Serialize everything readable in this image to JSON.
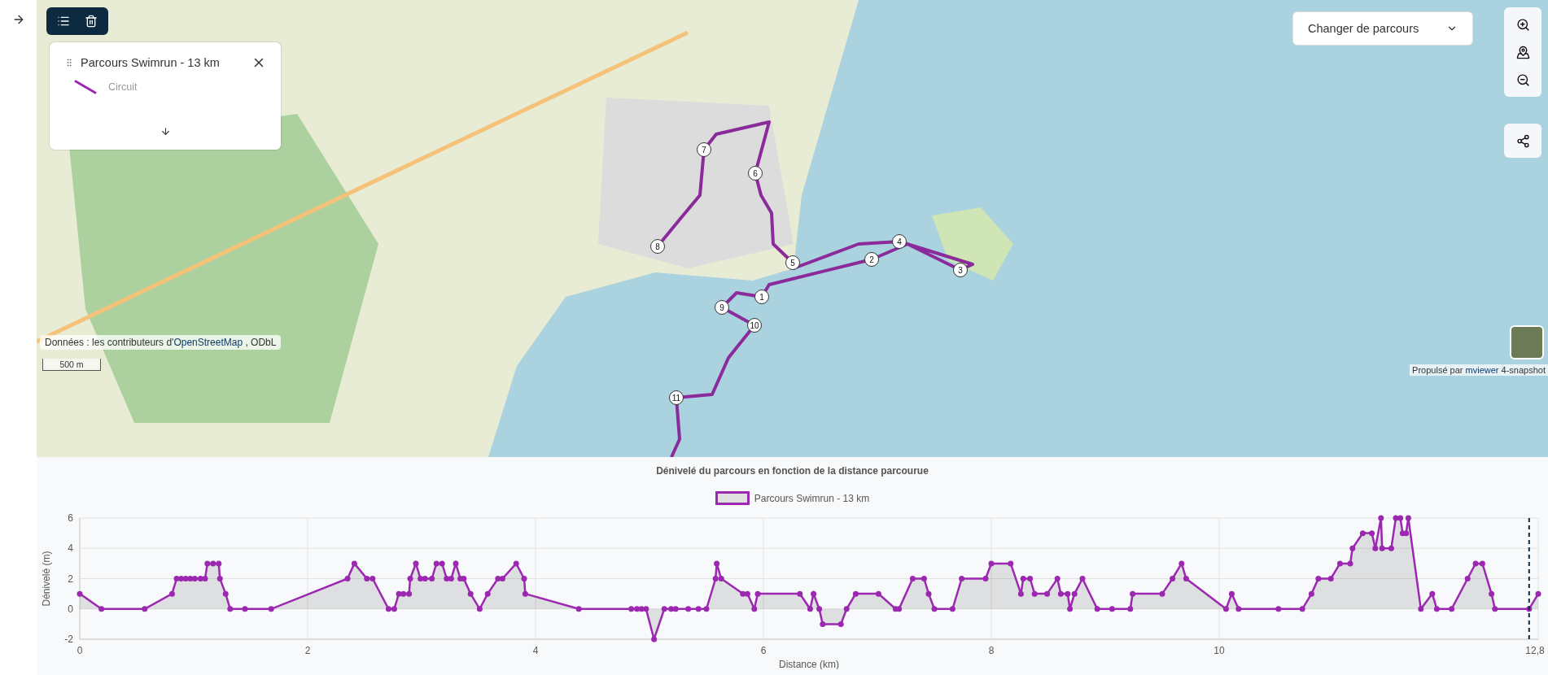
{
  "map": {
    "layer_panel": {
      "title": "Parcours Swimrun - 13 km",
      "layers": [
        {
          "label": "Circuit"
        }
      ]
    },
    "route_select": {
      "label": "Changer de parcours"
    },
    "markers": [
      {
        "label": "1"
      },
      {
        "label": "2"
      },
      {
        "label": "3"
      },
      {
        "label": "4"
      },
      {
        "label": "5"
      },
      {
        "label": "6"
      },
      {
        "label": "7"
      },
      {
        "label": "8"
      },
      {
        "label": "9"
      },
      {
        "label": "10"
      },
      {
        "label": "11"
      }
    ],
    "attribution": {
      "text": "Données : les contributeurs d'",
      "link": "OpenStreetMap",
      "suffix": " , ODbL"
    },
    "scale": "500 m",
    "credits": {
      "text": "Propulsé par",
      "link": "mviewer",
      "suffix": "4-snapshot"
    }
  },
  "profile": {
    "chart_data": {
      "type": "area",
      "title": "Dénivelé du parcours en fonction de la distance parcourue",
      "xlabel": "Distance (km)",
      "ylabel": "Dénivelé (m)",
      "x": [
        0,
        0.19,
        0.57,
        0.81,
        0.85,
        0.89,
        0.93,
        0.97,
        1.01,
        1.06,
        1.1,
        1.12,
        1.17,
        1.22,
        1.23,
        1.28,
        1.32,
        1.45,
        1.68,
        2.35,
        2.41,
        2.52,
        2.57,
        2.71,
        2.76,
        2.8,
        2.84,
        2.89,
        2.9,
        2.95,
        2.99,
        3.03,
        3.09,
        3.13,
        3.18,
        3.22,
        3.26,
        3.3,
        3.34,
        3.37,
        3.43,
        3.51,
        3.58,
        3.67,
        3.71,
        3.83,
        3.9,
        3.91,
        4.38,
        4.84,
        4.89,
        4.93,
        4.97,
        5.04,
        5.13,
        5.19,
        5.23,
        5.34,
        5.43,
        5.5,
        5.58,
        5.59,
        5.63,
        5.82,
        5.86,
        5.92,
        5.95,
        6.32,
        6.41,
        6.44,
        6.49,
        6.52,
        6.68,
        6.73,
        6.81,
        7.01,
        7.16,
        7.19,
        7.31,
        7.41,
        7.45,
        7.5,
        7.66,
        7.74,
        7.95,
        8.0,
        8.17,
        8.26,
        8.28,
        8.34,
        8.38,
        8.49,
        8.58,
        8.61,
        8.67,
        8.69,
        8.73,
        8.8,
        8.93,
        9.06,
        9.22,
        9.24,
        9.5,
        9.59,
        9.67,
        9.71,
        10.06,
        10.11,
        10.17,
        10.52,
        10.73,
        10.81,
        10.87,
        10.98,
        11.06,
        11.15,
        11.17,
        11.26,
        11.34,
        11.37,
        11.42,
        11.43,
        11.51,
        11.55,
        11.59,
        11.61,
        11.64,
        11.66,
        11.77,
        11.87,
        11.91,
        12.04,
        12.18,
        12.25,
        12.31,
        12.39,
        12.42,
        12.72,
        12.8
      ],
      "series": [
        {
          "name": "Parcours Swimrun - 13 km",
          "color": "#9c27b0",
          "values": [
            1,
            0,
            0,
            1,
            2,
            2,
            2,
            2,
            2,
            2,
            2,
            3,
            3,
            3,
            2,
            1,
            0,
            0,
            0,
            2,
            3,
            2,
            2,
            0,
            0,
            1,
            1,
            1,
            2,
            3,
            2,
            2,
            2,
            3,
            3,
            2,
            2,
            3,
            2,
            2,
            1,
            0,
            1,
            2,
            2,
            3,
            2,
            1,
            0,
            0,
            0,
            0,
            0,
            -2,
            0,
            0,
            0,
            0,
            0,
            0,
            2,
            3,
            2,
            1,
            1,
            0,
            1,
            1,
            0,
            1,
            0,
            -1,
            -1,
            0,
            1,
            1,
            0,
            0,
            2,
            2,
            1,
            0,
            0,
            2,
            2,
            3,
            3,
            1,
            2,
            2,
            1,
            1,
            2,
            1,
            1,
            0,
            1,
            2,
            0,
            0,
            0,
            1,
            1,
            2,
            3,
            2,
            0,
            1,
            0,
            0,
            0,
            1,
            2,
            2,
            3,
            3,
            4,
            5,
            5,
            4,
            6,
            4,
            4,
            6,
            6,
            5,
            5,
            6,
            0,
            1,
            0,
            0,
            2,
            3,
            3,
            1,
            0,
            0,
            1
          ]
        }
      ],
      "xlim": [
        0,
        12.8
      ],
      "ylim": [
        -2,
        6
      ],
      "xticks": [
        0,
        2,
        4,
        6,
        8,
        10,
        {
          "value": 12.8,
          "label": "12,8"
        }
      ],
      "yticks": [
        -2,
        0,
        2,
        4,
        6
      ],
      "grid": true,
      "ref_lines": [
        {
          "axis": "x",
          "value": 12.72
        }
      ]
    }
  }
}
